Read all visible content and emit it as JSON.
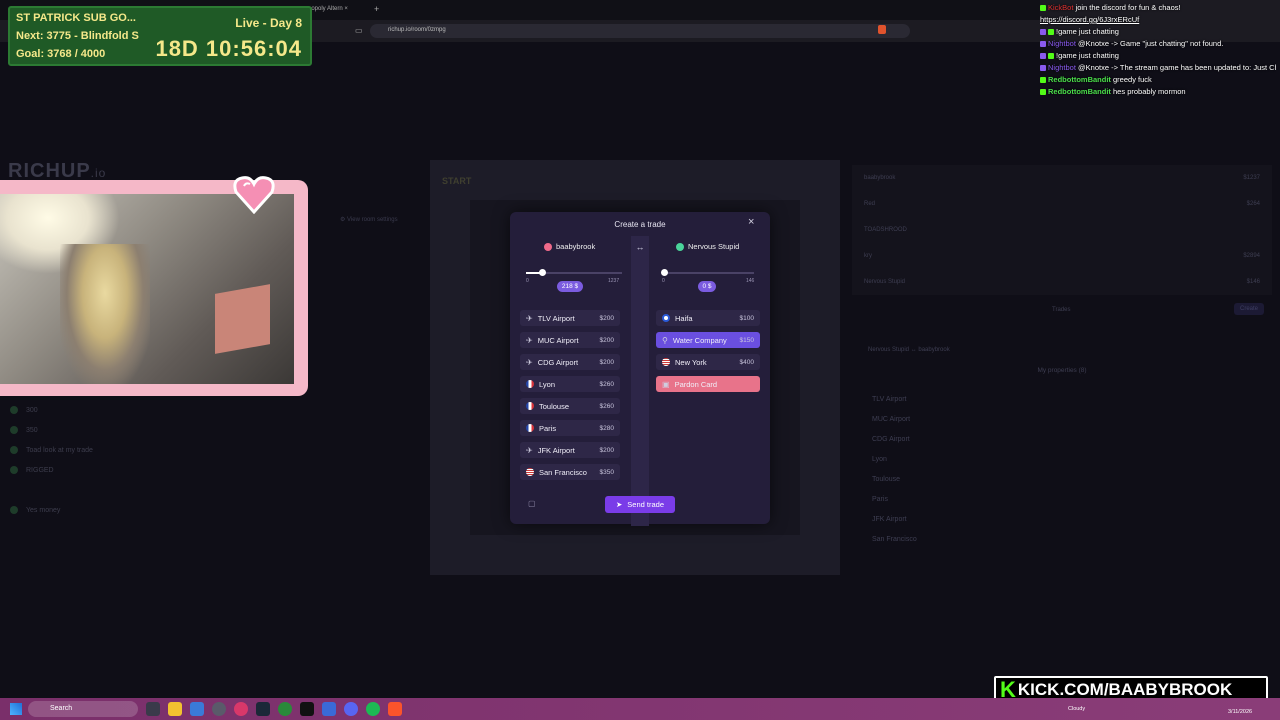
{
  "browser": {
    "tab_label": "nopoly Altern",
    "url": "richup.io/room/0zmpg"
  },
  "subgoal": {
    "title": "ST PATRICK SUB GO...",
    "next": "Next: 3775 - Blindfold S",
    "goal": "Goal: 3768 / 4000",
    "live": "Live - Day 8",
    "timer": "18D  10:56:04"
  },
  "twitch_chat": [
    {
      "user": "KickBot",
      "text": "join the discord for fun & chaos!",
      "color": "#e03030"
    },
    {
      "user": "",
      "text": "https://discord.gg/6J3rxERcUf",
      "color": "#ffffff"
    },
    {
      "user": "",
      "text": "!game just chatting",
      "color": "#7a7af0"
    },
    {
      "user": "Nightbot",
      "text": "@Knotxe -> Game \"just chatting\" not found.",
      "color": "#8a5af0"
    },
    {
      "user": "",
      "text": "!game just chatting",
      "color": "#7a7af0"
    },
    {
      "user": "Nightbot",
      "text": "@Knotxe -> The stream game has been updated to: Just Chatting",
      "color": "#8a5af0"
    },
    {
      "user": "RedbottomBandit",
      "text": "greedy fuck",
      "color": "#4ade4a"
    },
    {
      "user": "RedbottomBandit",
      "text": "hes probably mormon",
      "color": "#4ade4a"
    }
  ],
  "background": {
    "logo": "RICHUP",
    "logo_suffix": ".io",
    "room_settings": "View room settings",
    "left_chat": [
      "300",
      "350",
      "Toad look at my trade",
      "RIGGED",
      "Yes money"
    ],
    "players": [
      {
        "name": "baabybrook",
        "money": "$1237"
      },
      {
        "name": "Red",
        "money": "$264"
      },
      {
        "name": "TOADSHROOD",
        "money": ""
      },
      {
        "name": "kry",
        "money": "$2894"
      },
      {
        "name": "Nervous Stupid",
        "money": "$146"
      }
    ],
    "trades_label": "Trades",
    "create_label": "Create",
    "my_properties": "My properties (8)",
    "trade_row": "Nervous Stupid  ↔  baabybrook",
    "props": [
      "TLV Airport",
      "MUC Airport",
      "CDG Airport",
      "Lyon",
      "Toulouse",
      "Paris",
      "JFK Airport",
      "San Francisco"
    ]
  },
  "modal": {
    "title": "Create a trade",
    "left_player": "baabybrook",
    "right_player": "Nervous Stupid",
    "left_min": "0",
    "left_max": "1237",
    "left_money": "218 $",
    "right_min": "0",
    "right_max": "146",
    "right_money": "0 $",
    "send_label": "Send trade",
    "left_props": [
      {
        "name": "TLV Airport",
        "price": "$200",
        "kind": "airport"
      },
      {
        "name": "MUC Airport",
        "price": "$200",
        "kind": "airport"
      },
      {
        "name": "CDG Airport",
        "price": "$200",
        "kind": "airport"
      },
      {
        "name": "Lyon",
        "price": "$260",
        "kind": "fr"
      },
      {
        "name": "Toulouse",
        "price": "$260",
        "kind": "fr"
      },
      {
        "name": "Paris",
        "price": "$280",
        "kind": "fr"
      },
      {
        "name": "JFK Airport",
        "price": "$200",
        "kind": "airport"
      },
      {
        "name": "San Francisco",
        "price": "$350",
        "kind": "us"
      }
    ],
    "right_props": [
      {
        "name": "Haifa",
        "price": "$100",
        "kind": "il"
      },
      {
        "name": "Water Company",
        "price": "$150",
        "kind": "utility"
      },
      {
        "name": "New York",
        "price": "$400",
        "kind": "us"
      },
      {
        "name": "Pardon Card",
        "price": "",
        "kind": "card"
      }
    ]
  },
  "taskbar": {
    "search": "Search",
    "time": "",
    "date": "3/11/2026",
    "weather": "Cloudy"
  },
  "kick_banner": "KICK.COM/BAABYBROOK",
  "colors": {
    "accent": "#7a3ce8",
    "selected": "#6a4fe0",
    "card": "#e8738a",
    "goal_green": "#1f5a26"
  }
}
